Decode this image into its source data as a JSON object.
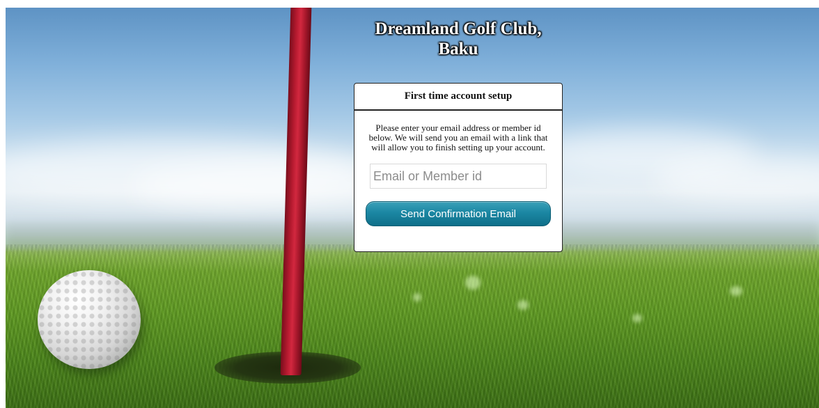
{
  "header": {
    "title": "Dreamland Golf Club, Baku"
  },
  "setup_panel": {
    "heading": "First time account setup",
    "description": "Please enter your email address or member id below. We will send you an email with a link that will allow you to finish setting up your account.",
    "email_input": {
      "placeholder": "Email or Member id",
      "value": ""
    },
    "submit_label": "Send Confirmation Email"
  },
  "colors": {
    "button_primary": "#1b87a3",
    "panel_border": "#222222",
    "flag_pole": "#c0213a"
  }
}
